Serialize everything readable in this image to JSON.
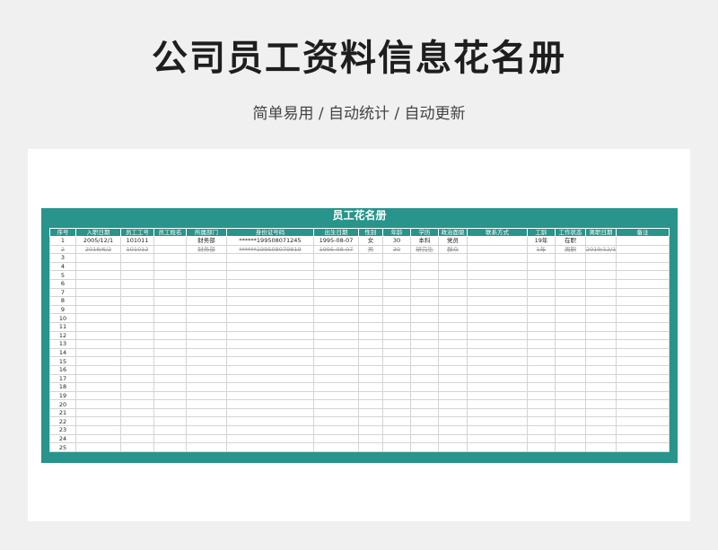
{
  "header": {
    "title": "公司员工资料信息花名册",
    "subtitle": "简单易用 / 自动统计 / 自动更新"
  },
  "sheet": {
    "title": "员工花名册",
    "columns": [
      "序号",
      "入职日期",
      "员工工号",
      "员工姓名",
      "所属部门",
      "身份证号码",
      "出生日期",
      "性别",
      "年龄",
      "学历",
      "政治面貌",
      "联系方式",
      "工龄",
      "工作状态",
      "离职日期",
      "备注"
    ],
    "rows": [
      [
        "1",
        "2005/12/1",
        "101011",
        "",
        "财务部",
        "******199508071245",
        "1995-08-07",
        "女",
        "30",
        "本科",
        "党员",
        "",
        "19年",
        "在职",
        "",
        ""
      ],
      [
        "2",
        "2018/6/2",
        "101012",
        "",
        "财务部",
        "******199508079819",
        "1995-08-07",
        "男",
        "30",
        "研究生",
        "群众",
        "",
        "1年",
        "离职",
        "2019/12/1",
        ""
      ],
      [
        "3",
        "",
        "",
        "",
        "",
        "",
        "",
        "",
        "",
        "",
        "",
        "",
        "",
        "",
        "",
        ""
      ],
      [
        "4",
        "",
        "",
        "",
        "",
        "",
        "",
        "",
        "",
        "",
        "",
        "",
        "",
        "",
        "",
        ""
      ],
      [
        "5",
        "",
        "",
        "",
        "",
        "",
        "",
        "",
        "",
        "",
        "",
        "",
        "",
        "",
        "",
        ""
      ],
      [
        "6",
        "",
        "",
        "",
        "",
        "",
        "",
        "",
        "",
        "",
        "",
        "",
        "",
        "",
        "",
        ""
      ],
      [
        "7",
        "",
        "",
        "",
        "",
        "",
        "",
        "",
        "",
        "",
        "",
        "",
        "",
        "",
        "",
        ""
      ],
      [
        "8",
        "",
        "",
        "",
        "",
        "",
        "",
        "",
        "",
        "",
        "",
        "",
        "",
        "",
        "",
        ""
      ],
      [
        "9",
        "",
        "",
        "",
        "",
        "",
        "",
        "",
        "",
        "",
        "",
        "",
        "",
        "",
        "",
        ""
      ],
      [
        "10",
        "",
        "",
        "",
        "",
        "",
        "",
        "",
        "",
        "",
        "",
        "",
        "",
        "",
        "",
        ""
      ],
      [
        "11",
        "",
        "",
        "",
        "",
        "",
        "",
        "",
        "",
        "",
        "",
        "",
        "",
        "",
        "",
        ""
      ],
      [
        "12",
        "",
        "",
        "",
        "",
        "",
        "",
        "",
        "",
        "",
        "",
        "",
        "",
        "",
        "",
        ""
      ],
      [
        "13",
        "",
        "",
        "",
        "",
        "",
        "",
        "",
        "",
        "",
        "",
        "",
        "",
        "",
        "",
        ""
      ],
      [
        "14",
        "",
        "",
        "",
        "",
        "",
        "",
        "",
        "",
        "",
        "",
        "",
        "",
        "",
        "",
        ""
      ],
      [
        "15",
        "",
        "",
        "",
        "",
        "",
        "",
        "",
        "",
        "",
        "",
        "",
        "",
        "",
        "",
        ""
      ],
      [
        "16",
        "",
        "",
        "",
        "",
        "",
        "",
        "",
        "",
        "",
        "",
        "",
        "",
        "",
        "",
        ""
      ],
      [
        "17",
        "",
        "",
        "",
        "",
        "",
        "",
        "",
        "",
        "",
        "",
        "",
        "",
        "",
        "",
        ""
      ],
      [
        "18",
        "",
        "",
        "",
        "",
        "",
        "",
        "",
        "",
        "",
        "",
        "",
        "",
        "",
        "",
        ""
      ],
      [
        "19",
        "",
        "",
        "",
        "",
        "",
        "",
        "",
        "",
        "",
        "",
        "",
        "",
        "",
        "",
        ""
      ],
      [
        "20",
        "",
        "",
        "",
        "",
        "",
        "",
        "",
        "",
        "",
        "",
        "",
        "",
        "",
        "",
        ""
      ],
      [
        "21",
        "",
        "",
        "",
        "",
        "",
        "",
        "",
        "",
        "",
        "",
        "",
        "",
        "",
        "",
        ""
      ],
      [
        "22",
        "",
        "",
        "",
        "",
        "",
        "",
        "",
        "",
        "",
        "",
        "",
        "",
        "",
        "",
        ""
      ],
      [
        "23",
        "",
        "",
        "",
        "",
        "",
        "",
        "",
        "",
        "",
        "",
        "",
        "",
        "",
        "",
        ""
      ],
      [
        "24",
        "",
        "",
        "",
        "",
        "",
        "",
        "",
        "",
        "",
        "",
        "",
        "",
        "",
        "",
        ""
      ],
      [
        "25",
        "",
        "",
        "",
        "",
        "",
        "",
        "",
        "",
        "",
        "",
        "",
        "",
        "",
        "",
        ""
      ]
    ],
    "struck_rows": [
      1
    ]
  },
  "colors": {
    "accent": "#28948b",
    "background": "#f0f0f0"
  }
}
